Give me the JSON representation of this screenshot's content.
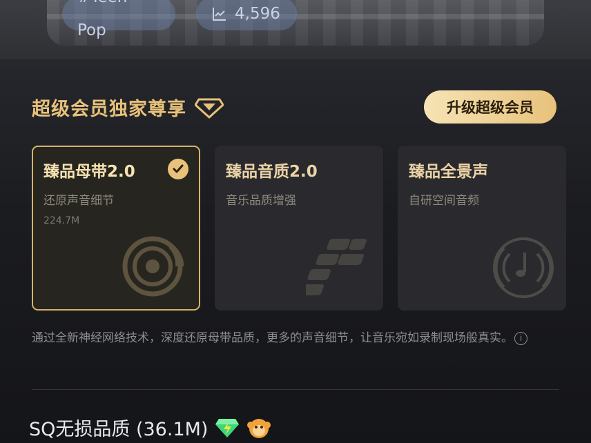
{
  "header": {
    "tag_label": "#Teen Pop",
    "play_count": "4,596",
    "play_icon": "trending-chart-icon"
  },
  "vip_section": {
    "title": "超级会员独家尊享",
    "title_icon": "diamond-icon",
    "upgrade_button": "升级超级会员",
    "accent_color": "#e8c27a"
  },
  "quality_cards": [
    {
      "title": "臻品母带2.0",
      "subtitle": "还原声音细节",
      "size": "224.7M",
      "selected": true,
      "icon": "vinyl-disc-icon"
    },
    {
      "title": "臻品音质2.0",
      "subtitle": "音乐品质增强",
      "selected": false,
      "icon": "blocks-icon"
    },
    {
      "title": "臻品全景声",
      "subtitle": "自研空间音频",
      "selected": false,
      "icon": "surround-sound-icon"
    }
  ],
  "description": "通过全新神经网络技术，深度还原母带品质，更多的声音细节，让音乐宛如录制现场般真实。",
  "sq_option": {
    "label": "SQ无损品质 (36.1M)",
    "badges": [
      "green-diamond-icon",
      "orange-monkey-icon"
    ]
  }
}
